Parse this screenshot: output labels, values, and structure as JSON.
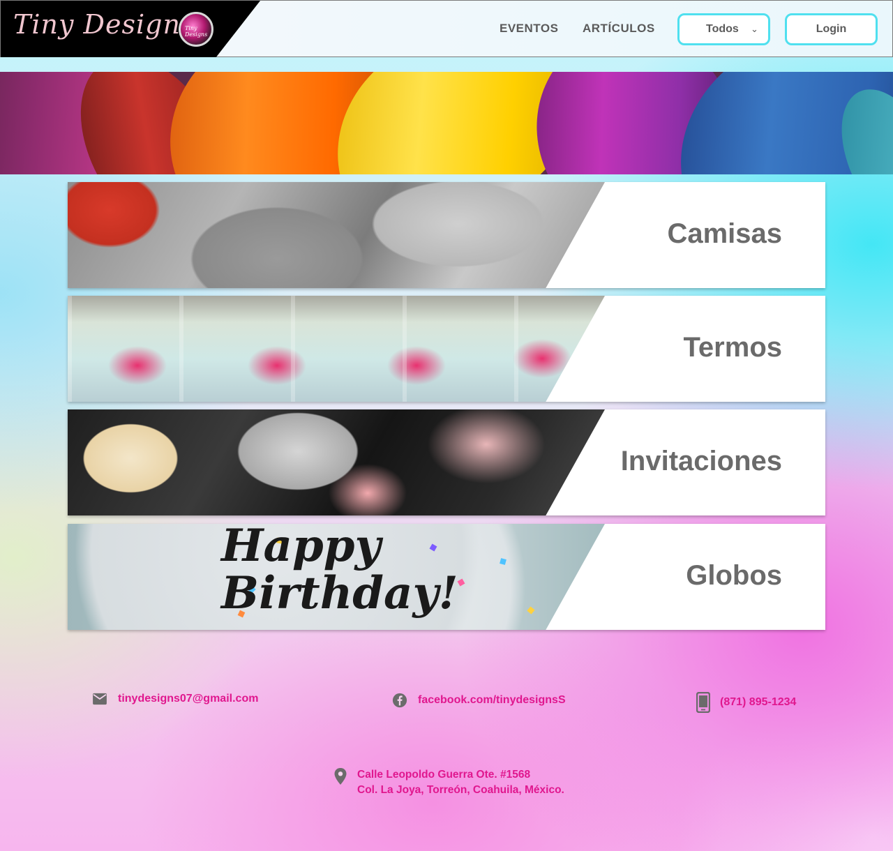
{
  "brand": {
    "logo_text": "Tiny Designs",
    "badge_text": "Tiny Designs"
  },
  "nav": {
    "eventos": "EVENTOS",
    "articulos": "ARTÍCULOS",
    "filter_selected": "Todos",
    "login": "Login"
  },
  "categories": [
    {
      "label": "Camisas"
    },
    {
      "label": "Termos"
    },
    {
      "label": "Invitaciones"
    },
    {
      "label": "Globos"
    }
  ],
  "globos_photo_text": "Happy\nBirthday!",
  "contact": {
    "email": "tinydesigns07@gmail.com",
    "facebook": "facebook.com/tinydesignsS",
    "phone": "(871) 895-1234",
    "address_line1": "Calle Leopoldo Guerra Ote. #1568",
    "address_line2": "Col. La Joya, Torreón, Coahuila, México."
  },
  "colors": {
    "accent_border": "#4fe0ef",
    "contact_pink": "#e0178e",
    "label_gray": "#6a6a6a",
    "logo_bg": "#000000"
  },
  "icons": {
    "email": "mail-icon",
    "facebook": "facebook-icon",
    "phone": "smartphone-icon",
    "address": "location-pin-icon",
    "select": "chevron-down-icon"
  }
}
